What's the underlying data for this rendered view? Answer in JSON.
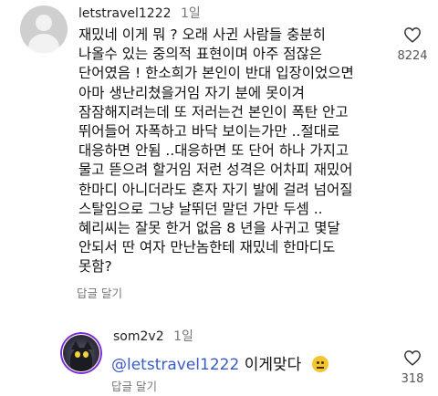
{
  "comments": [
    {
      "username": "letstravel1222",
      "time": "1일",
      "lines": [
        "재밌네 이게 뭐 ? 오래 사귄 사람들 충분히",
        "나올수 있는 중의적 표현이며 아주 점잖은",
        "단어였음 ! 한소희가 본인이 반대 입장이었으면",
        "아마 생난리쳤을거임 자기 분에 못이겨",
        "잠잠해지려는데 또 저러는건 본인이 폭탄 안고",
        "뛰어들어 자폭하고 바닥 보이는가만 ..절대로",
        "대응하면 안됨 ..대응하면 또 단어 하나 가지고",
        "물고 뜯으려 할거임 저런 성격은 어차피 재밌어",
        "한마디 아니더라도 혼자 자기 발에 걸려 넘어질",
        "스탈임으로 그냥 날뛰던 말던 가만 두셈 ..",
        "혜리씨는 잘못 한거 없음 8 년을 사귀고 몇달",
        "안되서 딴 여자 만난놈한테 재밌네 한마디도",
        "못함?"
      ],
      "reply_label": "답글",
      "more_label": "달기",
      "like_count": "8224",
      "like_icon": "heart-outline-icon"
    },
    {
      "username": "som2v2",
      "time": "1일",
      "mention": "@letstravel1222",
      "text": "이게맞다",
      "emoji": "grimacing-face-emoji",
      "reply_label": "답글",
      "more_label": "달기",
      "like_count": "318",
      "like_icon": "heart-outline-icon"
    }
  ]
}
